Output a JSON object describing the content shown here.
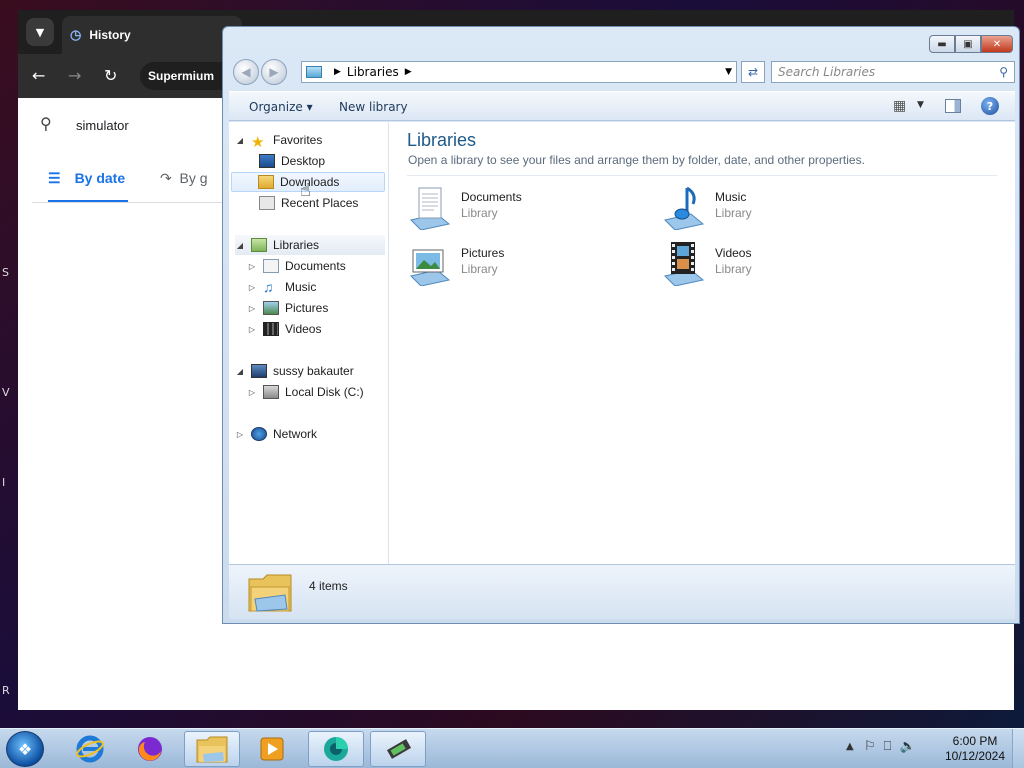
{
  "browser": {
    "tab_title": "History",
    "omnibox_text": "Supermium",
    "search_value": "simulator",
    "tab_by_date": "By date",
    "tab_by_group": "By g"
  },
  "desktop_edge_chars": [
    "S",
    "V",
    "I",
    "R"
  ],
  "explorer": {
    "breadcrumb": "Libraries",
    "search_placeholder": "Search Libraries",
    "commands": {
      "organize": "Organize",
      "new_library": "New library"
    },
    "nav": {
      "favorites": "Favorites",
      "desktop": "Desktop",
      "downloads": "Downloads",
      "recent_places": "Recent Places",
      "libraries": "Libraries",
      "documents": "Documents",
      "music": "Music",
      "pictures": "Pictures",
      "videos": "Videos",
      "computer": "sussy bakauter",
      "local_disk": "Local Disk (C:)",
      "network": "Network"
    },
    "content": {
      "title": "Libraries",
      "description": "Open a library to see your files and arrange them by folder, date, and other properties.",
      "items": [
        {
          "name": "Documents",
          "type": "Library",
          "icon": "documents-library-icon"
        },
        {
          "name": "Music",
          "type": "Library",
          "icon": "music-library-icon"
        },
        {
          "name": "Pictures",
          "type": "Library",
          "icon": "pictures-library-icon"
        },
        {
          "name": "Videos",
          "type": "Library",
          "icon": "videos-library-icon"
        }
      ]
    },
    "status": {
      "count": "4 items"
    }
  },
  "taskbar": {
    "time": "6:00 PM",
    "date": "10/12/2024"
  }
}
